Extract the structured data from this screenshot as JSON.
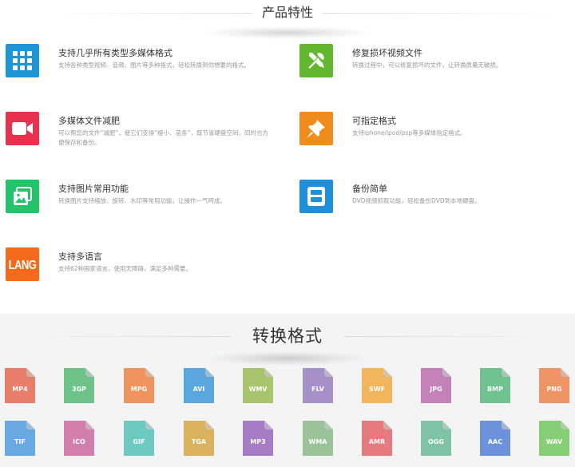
{
  "features_section": {
    "title": "产品特性",
    "items": [
      {
        "title": "支持几乎所有类型多媒体格式",
        "desc": "支持各种类型视频、音频、图片等多种格式，轻松转换到你想要的格式。",
        "icon": "grid-icon",
        "color": "#1e96d6"
      },
      {
        "title": "修复损坏视频文件",
        "desc": "转换过程中，可以修复损坏的文件，让转换质量无破损。",
        "icon": "tools-icon",
        "color": "#61b72e"
      },
      {
        "title": "多媒体文件减肥",
        "desc": "可以帮您的文件“减肥”，使它们变得“瘦小、苗条”，既节省硬盘空间，同时也方便保存和备份。",
        "icon": "video-camera-icon",
        "color": "#e8304f"
      },
      {
        "title": "可指定格式",
        "desc": "支持iphone/ipod/psp等多媒体指定格式。",
        "icon": "pushpin-icon",
        "color": "#ef8c1e"
      },
      {
        "title": "支持图片常用功能",
        "desc": "转换图片支持缩放、旋转、水印等常用功能，让操作一气呵成。",
        "icon": "pictures-icon",
        "color": "#25c369"
      },
      {
        "title": "备份简单",
        "desc": "DVD视频抓取功能，轻松备份DVD到本地硬盘。",
        "icon": "backup-icon",
        "color": "#1e8fd8"
      },
      {
        "title": "支持多语言",
        "desc": "支持62种国家语言，使用无障碍，满足多种需要。",
        "icon": "lang-icon",
        "icon_text": "LANG",
        "color": "#f26b1d"
      }
    ]
  },
  "formats_section": {
    "title": "转换格式",
    "items": [
      {
        "label": "MP4",
        "color": "#e87d6a"
      },
      {
        "label": "3GP",
        "color": "#6dc387"
      },
      {
        "label": "MPG",
        "color": "#f0935c"
      },
      {
        "label": "AVI",
        "color": "#5aa6de"
      },
      {
        "label": "WMV",
        "color": "#a8c56e"
      },
      {
        "label": "FLV",
        "color": "#a690c9"
      },
      {
        "label": "SWF",
        "color": "#f2b55b"
      },
      {
        "label": "JPG",
        "color": "#c582b8"
      },
      {
        "label": "BMP",
        "color": "#6fc391"
      },
      {
        "label": "PNG",
        "color": "#ef9565"
      },
      {
        "label": "TIF",
        "color": "#67a9e0"
      },
      {
        "label": "ICO",
        "color": "#d37fae"
      },
      {
        "label": "GIF",
        "color": "#6dcac3"
      },
      {
        "label": "TGA",
        "color": "#dbb35e"
      },
      {
        "label": "MP3",
        "color": "#a67cc6"
      },
      {
        "label": "WMA",
        "color": "#9bc39a"
      },
      {
        "label": "AMR",
        "color": "#e67a7f"
      },
      {
        "label": "OGG",
        "color": "#7ec3a4"
      },
      {
        "label": "AAC",
        "color": "#6b92da"
      },
      {
        "label": "WAV",
        "color": "#86cf76"
      }
    ]
  }
}
